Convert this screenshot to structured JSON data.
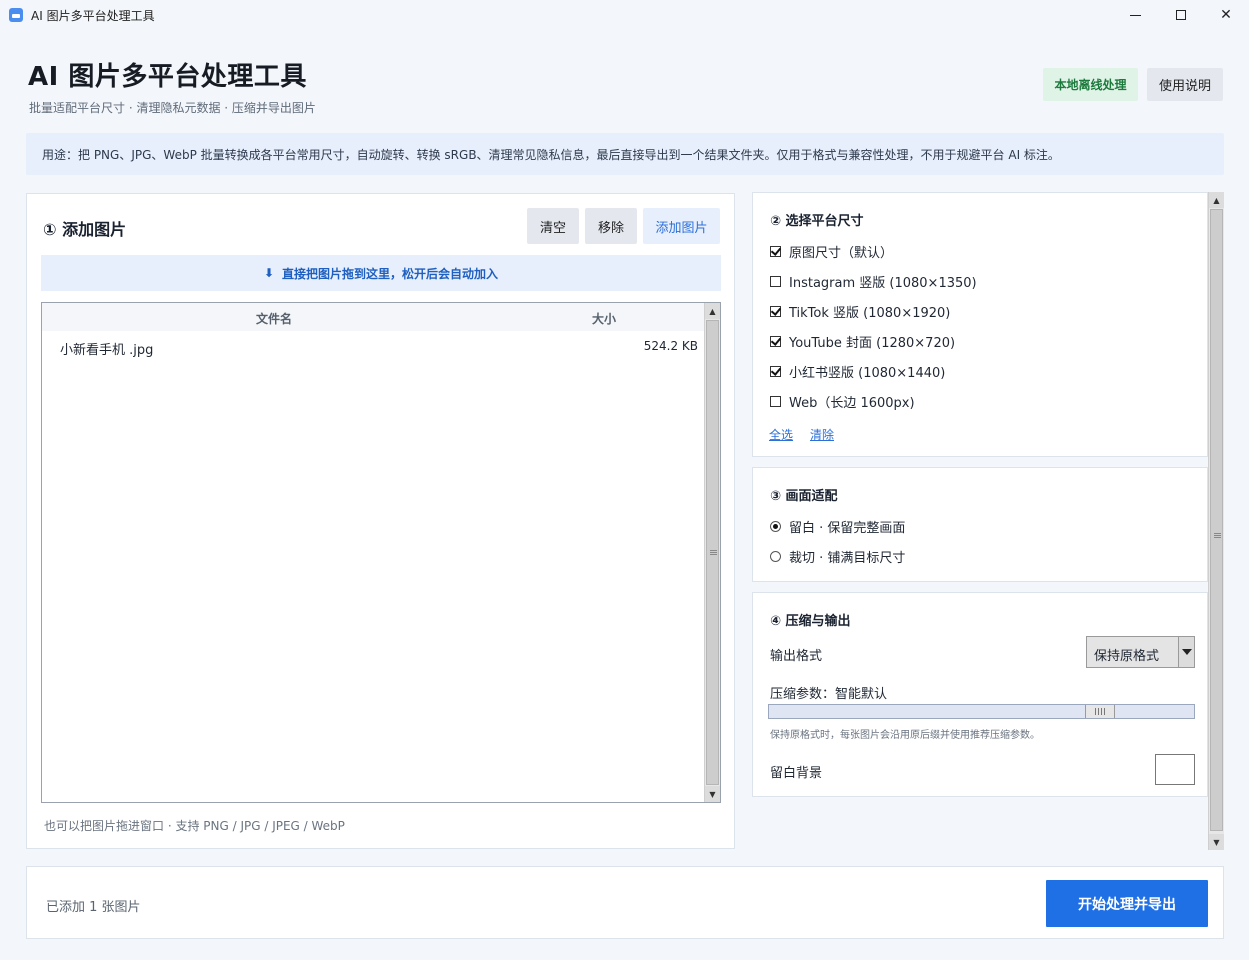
{
  "window": {
    "title": "AI 图片多平台处理工具"
  },
  "header": {
    "title": "AI 图片多平台处理工具",
    "subtitle": "批量适配平台尺寸 · 清理隐私元数据 · 压缩并导出图片",
    "badge": "本地离线处理",
    "help_label": "使用说明"
  },
  "notice": "用途：把 PNG、JPG、WebP 批量转换成各平台常用尺寸，自动旋转、转换 sRGB、清理常见隐私信息，最后直接导出到一个结果文件夹。仅用于格式与兼容性处理，不用于规避平台 AI 标注。",
  "add_images": {
    "title": "① 添加图片",
    "clear_label": "清空",
    "remove_label": "移除",
    "add_label": "添加图片",
    "drop_hint": "直接把图片拖到这里，松开后会自动加入",
    "columns": [
      "文件名",
      "大小"
    ],
    "files": [
      {
        "name": "小新看手机 .jpg",
        "size": "524.2 KB"
      }
    ],
    "footer": "也可以把图片拖进窗口 · 支持 PNG / JPG / JPEG / WebP",
    "scroll_thumb_fraction": 1.0
  },
  "platform_sizes": {
    "title": "② 选择平台尺寸",
    "options": [
      {
        "label": "原图尺寸（默认）",
        "checked": true
      },
      {
        "label": "Instagram 竖版 (1080×1350)",
        "checked": false
      },
      {
        "label": "TikTok 竖版 (1080×1920)",
        "checked": true
      },
      {
        "label": "YouTube 封面 (1280×720)",
        "checked": true
      },
      {
        "label": "小红书竖版 (1080×1440)",
        "checked": true
      },
      {
        "label": "Web（长边 1600px)",
        "checked": false
      }
    ],
    "select_all_label": "全选",
    "clear_label": "清除"
  },
  "fit": {
    "title": "③ 画面适配",
    "options": [
      {
        "label": "留白 · 保留完整画面",
        "selected": true
      },
      {
        "label": "裁切 · 铺满目标尺寸",
        "selected": false
      }
    ]
  },
  "output": {
    "title": "④ 压缩与输出",
    "format_label": "输出格式",
    "format_value": "保持原格式",
    "compress_label": "压缩参数：智能默认",
    "compress_level": 0.8,
    "hint": "保持原格式时，每张图片会沿用原后缀并使用推荐压缩参数。",
    "background_label": "留白背景",
    "background_color": "#ffffff"
  },
  "footer": {
    "status": "已添加 1 张图片",
    "start_label": "开始处理并导出"
  }
}
